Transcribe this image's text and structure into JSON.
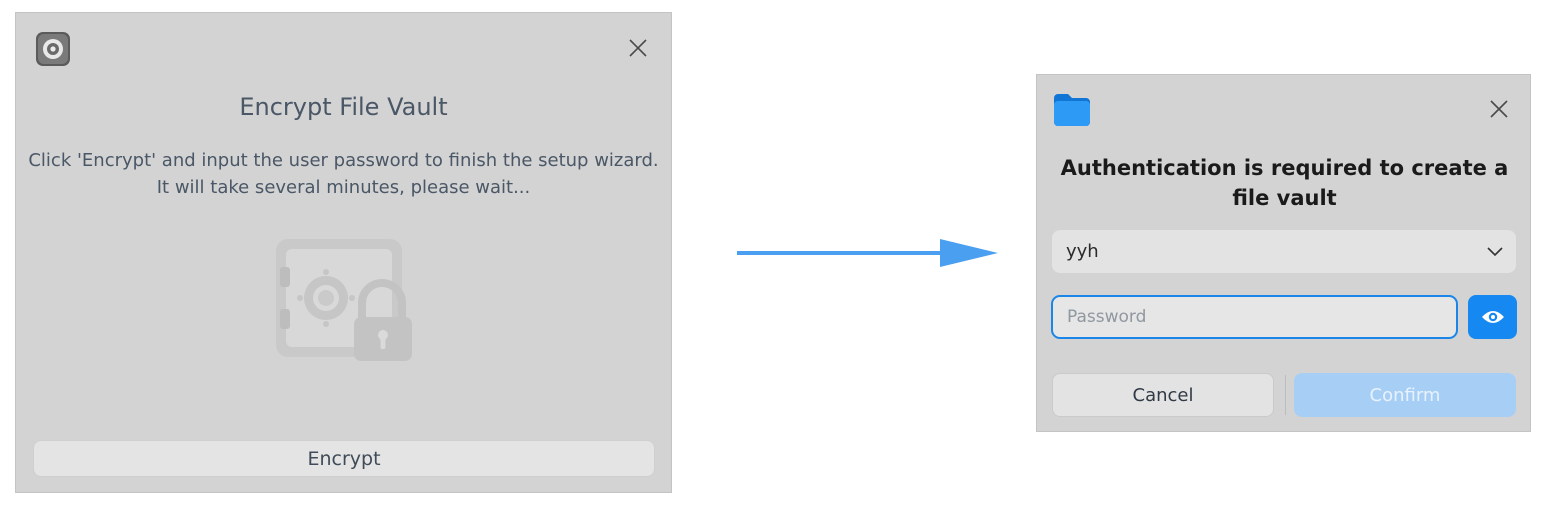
{
  "encrypt_dialog": {
    "app_icon": "disk-lock-icon",
    "close_icon": "close-icon",
    "title": "Encrypt File Vault",
    "description_line1": "Click 'Encrypt' and input the user password to finish the setup wizard.",
    "description_line2": "It will take several minutes, please wait...",
    "illustration": "safe-with-padlock-icon",
    "encrypt_button": "Encrypt"
  },
  "arrow": {
    "icon": "arrow-right-icon",
    "color": "#4a9ff0"
  },
  "auth_dialog": {
    "app_icon": "folder-icon",
    "close_icon": "close-icon",
    "title": "Authentication is required to create a file vault",
    "user_select": {
      "value": "yyh",
      "icon": "chevron-down-icon"
    },
    "password": {
      "placeholder": "Password",
      "value": ""
    },
    "show_password_icon": "eye-icon",
    "cancel_label": "Cancel",
    "confirm_label": "Confirm"
  },
  "colors": {
    "dialog_bg": "#d3d3d3",
    "accent": "#1588f2",
    "confirm_disabled": "#a7cff5",
    "focus_border": "#1b86e8"
  }
}
